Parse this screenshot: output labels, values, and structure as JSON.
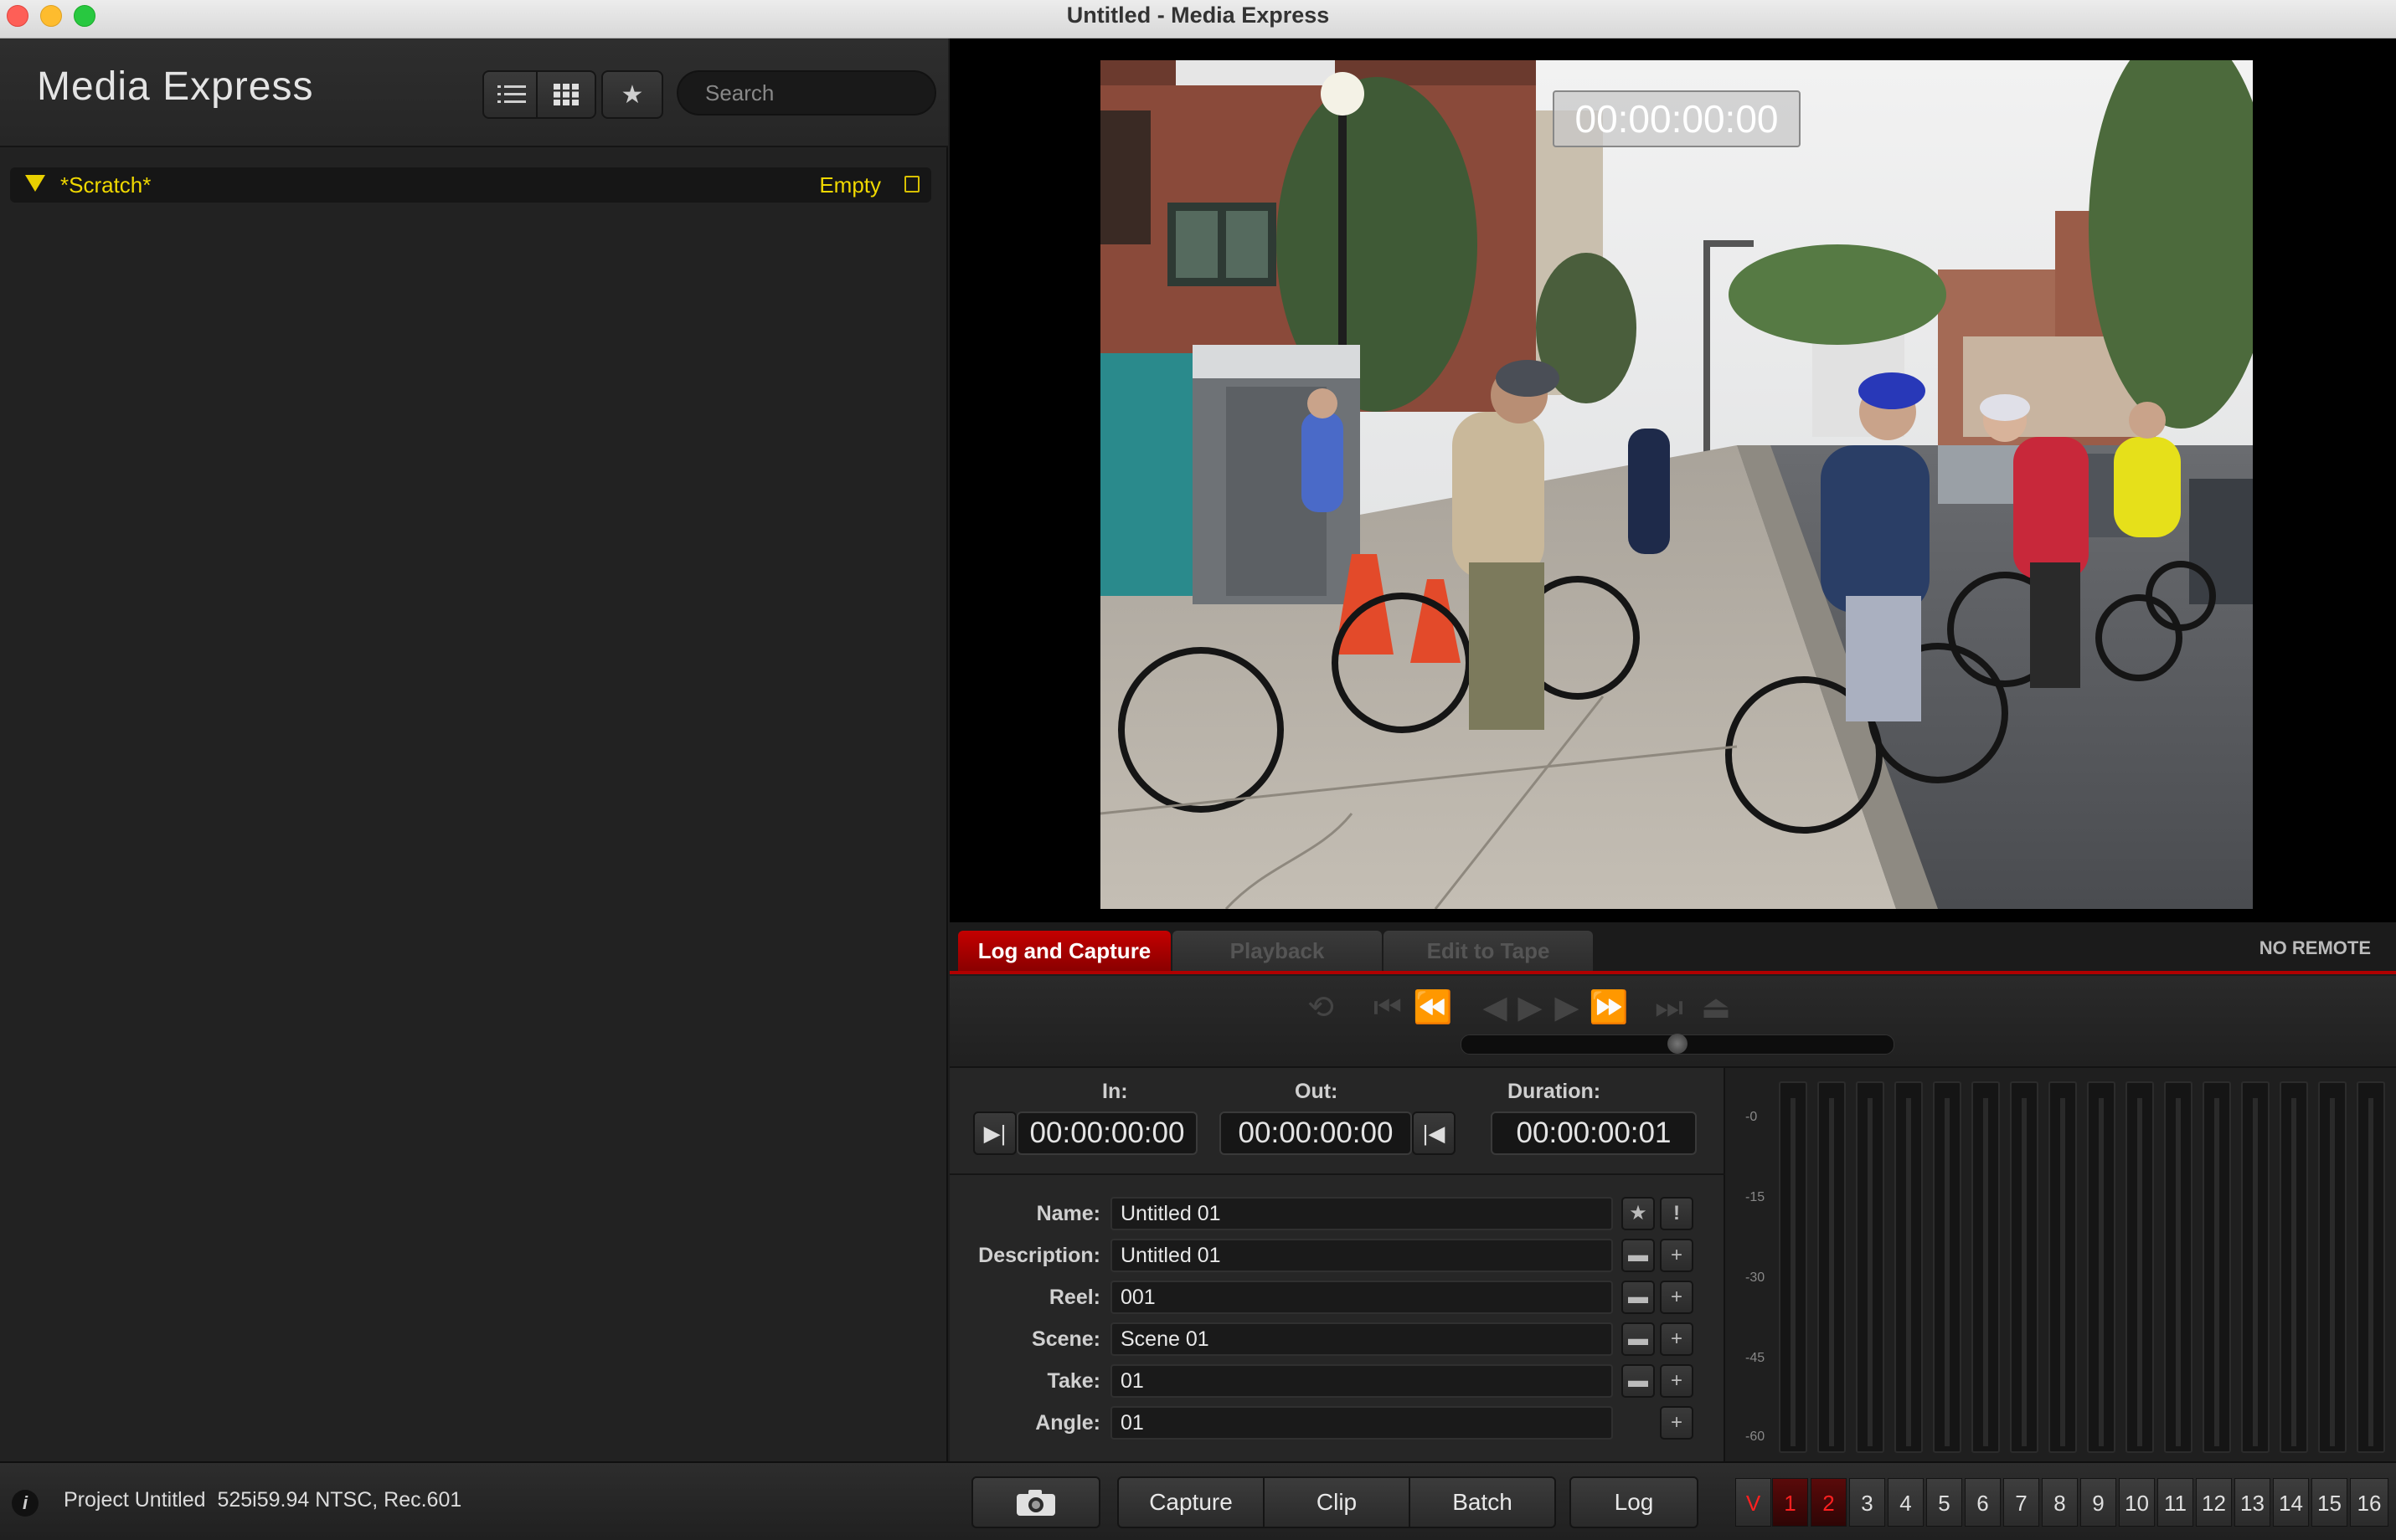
{
  "window": {
    "title": "Untitled - Media Express"
  },
  "sidebar": {
    "app_name": "Media Express",
    "search": {
      "placeholder": "Search"
    },
    "view_buttons": [
      {
        "icon": "list-view-icon"
      },
      {
        "icon": "grid-view-icon"
      },
      {
        "icon": "star-icon"
      }
    ],
    "bin": {
      "name": "*Scratch*",
      "status": "Empty"
    }
  },
  "viewer": {
    "timecode_overlay": "00:00:00:00"
  },
  "tabs": [
    {
      "label": "Log and Capture",
      "active": true
    },
    {
      "label": "Playback",
      "active": false
    },
    {
      "label": "Edit to Tape",
      "active": false
    }
  ],
  "remote_status": "NO REMOTE",
  "timecodes": {
    "in_label": "In:",
    "in_value": "00:00:00:00",
    "out_label": "Out:",
    "out_value": "00:00:00:00",
    "duration_label": "Duration:",
    "duration_value": "00:00:00:01"
  },
  "log_fields": [
    {
      "label": "Name:",
      "value": "Untitled 01"
    },
    {
      "label": "Description:",
      "value": "Untitled 01"
    },
    {
      "label": "Reel:",
      "value": "001"
    },
    {
      "label": "Scene:",
      "value": "Scene 01"
    },
    {
      "label": "Take:",
      "value": "01"
    },
    {
      "label": "Angle:",
      "value": "01"
    }
  ],
  "meter_scale": [
    "-0",
    "-15",
    "-30",
    "-45",
    "-60"
  ],
  "status_bar": {
    "project": "Project Untitled",
    "format": "525i59.94 NTSC, Rec.601"
  },
  "bottom_buttons": {
    "capture": "Capture",
    "clip": "Clip",
    "batch": "Batch",
    "log": "Log"
  },
  "channels": [
    "V",
    "1",
    "2",
    "3",
    "4",
    "5",
    "6",
    "7",
    "8",
    "9",
    "10",
    "11",
    "12",
    "13",
    "14",
    "15",
    "16"
  ],
  "colors": {
    "accent": "#c40000",
    "bin_text": "#f0d800"
  }
}
